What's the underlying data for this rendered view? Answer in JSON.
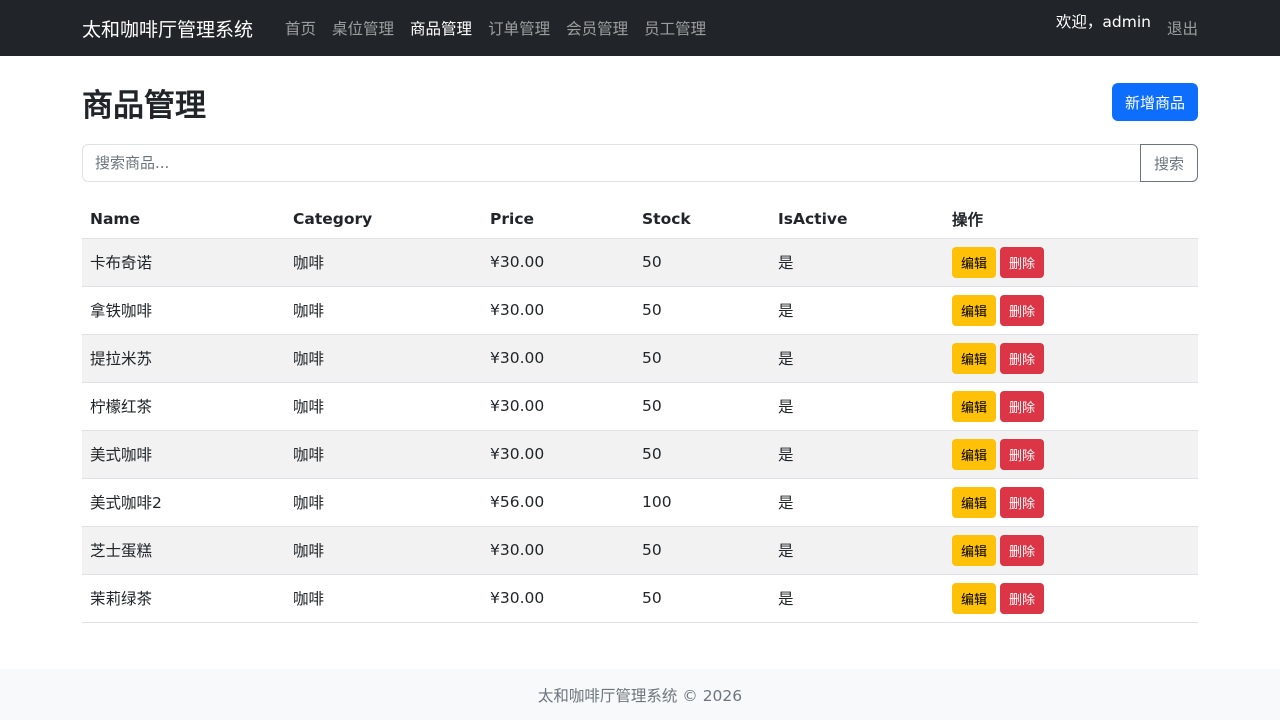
{
  "navbar": {
    "brand": "太和咖啡厅管理系统",
    "links": [
      "首页",
      "桌位管理",
      "商品管理",
      "订单管理",
      "会员管理",
      "员工管理"
    ],
    "active_index": 2,
    "welcome": "欢迎，admin",
    "logout": "退出"
  },
  "page": {
    "title": "商品管理",
    "new_button": "新增商品"
  },
  "search": {
    "placeholder": "搜索商品...",
    "button": "搜索"
  },
  "table": {
    "headers": [
      "Name",
      "Category",
      "Price",
      "Stock",
      "IsActive",
      "操作"
    ],
    "rows": [
      [
        "卡布奇诺",
        "咖啡",
        "¥30.00",
        "50",
        "是"
      ],
      [
        "拿铁咖啡",
        "咖啡",
        "¥30.00",
        "50",
        "是"
      ],
      [
        "提拉米苏",
        "咖啡",
        "¥30.00",
        "50",
        "是"
      ],
      [
        "柠檬红茶",
        "咖啡",
        "¥30.00",
        "50",
        "是"
      ],
      [
        "美式咖啡",
        "咖啡",
        "¥30.00",
        "50",
        "是"
      ],
      [
        "美式咖啡2",
        "咖啡",
        "¥56.00",
        "100",
        "是"
      ],
      [
        "芝士蛋糕",
        "咖啡",
        "¥30.00",
        "50",
        "是"
      ],
      [
        "茉莉绿茶",
        "咖啡",
        "¥30.00",
        "50",
        "是"
      ]
    ],
    "edit_label": "编辑",
    "delete_label": "删除"
  },
  "footer": {
    "text": "太和咖啡厅管理系统 © 2026"
  },
  "colors": {
    "navbar_bg": "#212529",
    "primary": "#0d6efd",
    "warning": "#ffc107",
    "danger": "#dc3545"
  }
}
